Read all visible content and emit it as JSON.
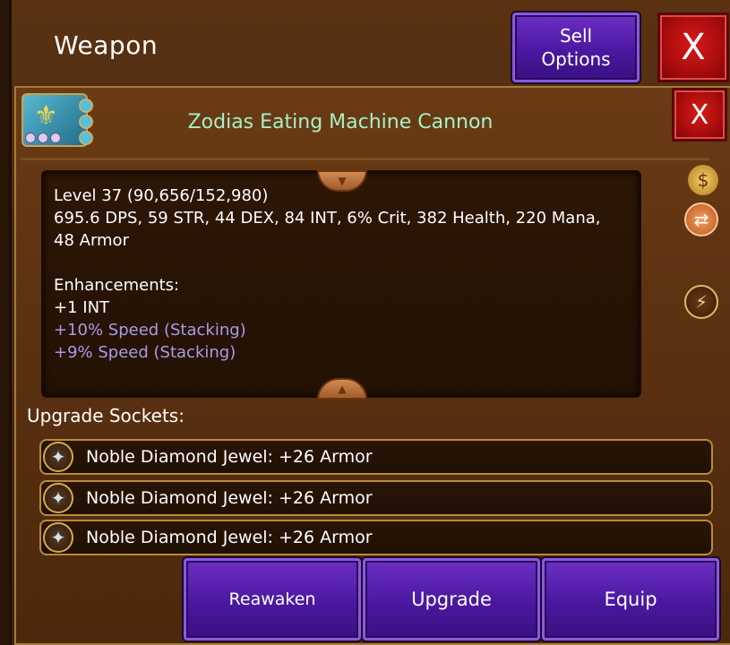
{
  "header": {
    "title": "Weapon",
    "sell_label_line1": "Sell",
    "sell_label_line2": "Options",
    "close_label": "X"
  },
  "item": {
    "name": "Zodias Eating Machine Cannon",
    "close_label": "X",
    "icon": "cannon-weapon-icon"
  },
  "stats": {
    "level_line": "Level 37 (90,656/152,980)",
    "stat_line1": "695.6 DPS, 59 STR, 44 DEX, 84 INT, 6% Crit, 382 Health, 220 Mana,",
    "stat_line2": "48 Armor",
    "enhancements_label": "Enhancements:",
    "enhancements": [
      "+1 INT",
      "+10% Speed (Stacking)",
      "+9% Speed (Stacking)"
    ]
  },
  "side_icons": [
    "money-bag-icon",
    "swap-icon",
    "boost-icon"
  ],
  "sockets": {
    "label": "Upgrade Sockets:",
    "items": [
      "Noble Diamond Jewel: +26 Armor",
      "Noble Diamond Jewel: +26 Armor",
      "Noble Diamond Jewel: +26 Armor"
    ]
  },
  "actions": {
    "reawaken": "Reawaken",
    "upgrade": "Upgrade",
    "equip": "Equip"
  },
  "colors": {
    "item_name": "#a6f0c8",
    "enhancement_bonus": "#a89be8",
    "button_purple": "#4a18a0",
    "button_red": "#a80c0c"
  }
}
